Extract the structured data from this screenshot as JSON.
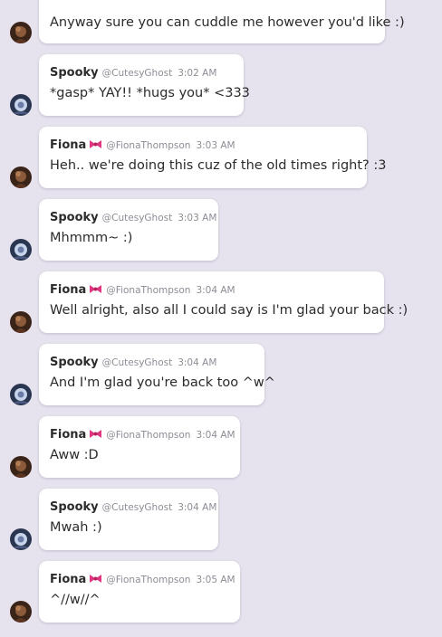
{
  "messages": [
    {
      "author": "",
      "handle": "",
      "time": "",
      "text": "Anyway sure you can cuddle me however you'd like :)",
      "avatar": "fiona-avatar"
    },
    {
      "author": "Spooky",
      "handle": "@CutesyGhost",
      "time": "3:02 AM",
      "text": "*gasp* YAY!! *hugs you* <333",
      "avatar": "spooky-avatar"
    },
    {
      "author": "Fiona",
      "handle": "@FionaThompson",
      "time": "3:03 AM",
      "text": "Heh.. we're doing this cuz of the old times right? :3",
      "avatar": "fiona-avatar",
      "badge": "pink-bow-emoji"
    },
    {
      "author": "Spooky",
      "handle": "@CutesyGhost",
      "time": "3:03 AM",
      "text": "Mhmmm~ :)",
      "avatar": "spooky-avatar"
    },
    {
      "author": "Fiona",
      "handle": "@FionaThompson",
      "time": "3:04 AM",
      "text": "Well alright, also all I could say is I'm glad your back :)",
      "avatar": "fiona-avatar",
      "badge": "pink-bow-emoji"
    },
    {
      "author": "Spooky",
      "handle": "@CutesyGhost",
      "time": "3:04 AM",
      "text": "And I'm glad you're back too ^w^",
      "avatar": "spooky-avatar"
    },
    {
      "author": "Fiona",
      "handle": "@FionaThompson",
      "time": "3:04 AM",
      "text": "Aww :D",
      "avatar": "fiona-avatar",
      "badge": "pink-bow-emoji"
    },
    {
      "author": "Spooky",
      "handle": "@CutesyGhost",
      "time": "3:04 AM",
      "text": "Mwah :)",
      "avatar": "spooky-avatar"
    },
    {
      "author": "Fiona",
      "handle": "@FionaThompson",
      "time": "3:05 AM",
      "text": "^//w//^",
      "avatar": "fiona-avatar",
      "badge": "pink-bow-emoji"
    }
  ],
  "colors": {
    "background": "#e7e3ee",
    "bubble": "#ffffff",
    "text": "#2b2b2b",
    "meta": "#8d8d96",
    "bow": "#e0357f"
  }
}
